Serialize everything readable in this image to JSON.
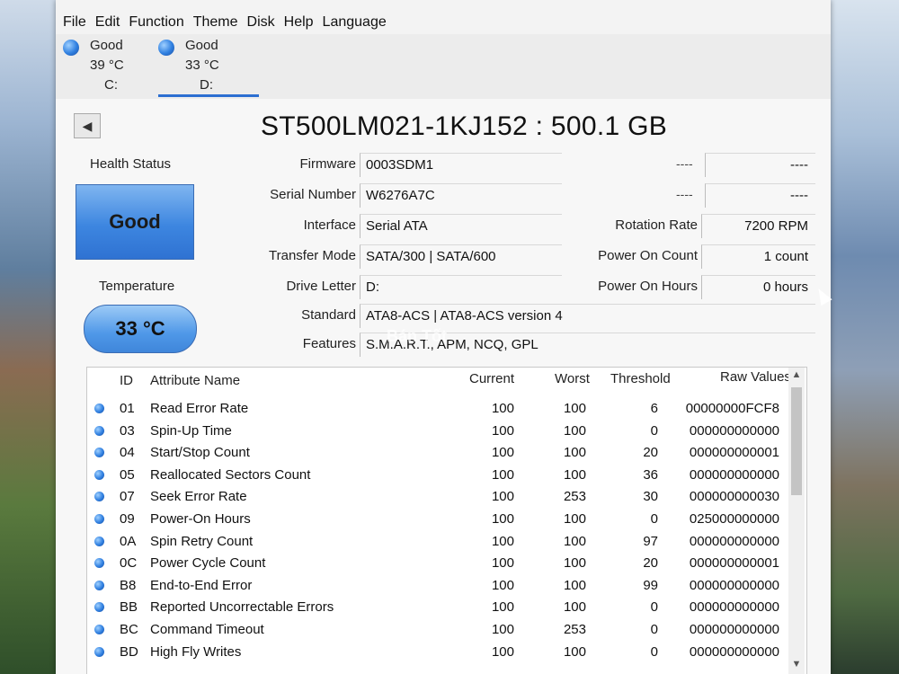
{
  "menu": [
    "File",
    "Edit",
    "Function",
    "Theme",
    "Disk",
    "Help",
    "Language"
  ],
  "drives": [
    {
      "status": "Good",
      "temp": "39 °C",
      "letter": "C:"
    },
    {
      "status": "Good",
      "temp": "33 °C",
      "letter": "D:"
    }
  ],
  "model_title": "ST500LM021-1KJ152 : 500.1 GB",
  "health": {
    "label": "Health Status",
    "value": "Good"
  },
  "temperature": {
    "label": "Temperature",
    "value": "33 °C"
  },
  "fields": {
    "firmware": {
      "label": "Firmware",
      "value": "0003SDM1"
    },
    "serial": {
      "label": "Serial Number",
      "value": "W6276A7C"
    },
    "interface": {
      "label": "Interface",
      "value": "Serial ATA"
    },
    "transfer": {
      "label": "Transfer Mode",
      "value": "SATA/300 | SATA/600"
    },
    "drive_letter": {
      "label": "Drive Letter",
      "value": "D:"
    },
    "standard": {
      "label": "Standard",
      "value": "ATA8-ACS | ATA8-ACS version 4"
    },
    "features": {
      "label": "Features",
      "value": "S.M.A.R.T., APM, NCQ, GPL"
    }
  },
  "right_fields": {
    "blank1": {
      "label": "----",
      "value": "----"
    },
    "blank2": {
      "label": "----",
      "value": "----"
    },
    "rotation": {
      "label": "Rotation Rate",
      "value": "7200 RPM"
    },
    "power_count": {
      "label": "Power On Count",
      "value": "1 count"
    },
    "power_hours": {
      "label": "Power On Hours",
      "value": "0 hours"
    }
  },
  "table": {
    "headers": [
      "ID",
      "Attribute Name",
      "Current",
      "Worst",
      "Threshold",
      "Raw Values"
    ],
    "rows": [
      [
        "01",
        "Read Error Rate",
        "100",
        "100",
        "6",
        "00000000FCF8"
      ],
      [
        "03",
        "Spin-Up Time",
        "100",
        "100",
        "0",
        "000000000000"
      ],
      [
        "04",
        "Start/Stop Count",
        "100",
        "100",
        "20",
        "000000000001"
      ],
      [
        "05",
        "Reallocated Sectors Count",
        "100",
        "100",
        "36",
        "000000000000"
      ],
      [
        "07",
        "Seek Error Rate",
        "100",
        "253",
        "30",
        "000000000030"
      ],
      [
        "09",
        "Power-On Hours",
        "100",
        "100",
        "0",
        "025000000000"
      ],
      [
        "0A",
        "Spin Retry Count",
        "100",
        "100",
        "97",
        "000000000000"
      ],
      [
        "0C",
        "Power Cycle Count",
        "100",
        "100",
        "20",
        "000000000001"
      ],
      [
        "B8",
        "End-to-End Error",
        "100",
        "100",
        "99",
        "000000000000"
      ],
      [
        "BB",
        "Reported Uncorrectable Errors",
        "100",
        "100",
        "0",
        "000000000000"
      ],
      [
        "BC",
        "Command Timeout",
        "100",
        "253",
        "0",
        "000000000000"
      ],
      [
        "BD",
        "High Fly Writes",
        "100",
        "100",
        "0",
        "000000000000"
      ]
    ]
  },
  "watermark": "Bán Tốt"
}
